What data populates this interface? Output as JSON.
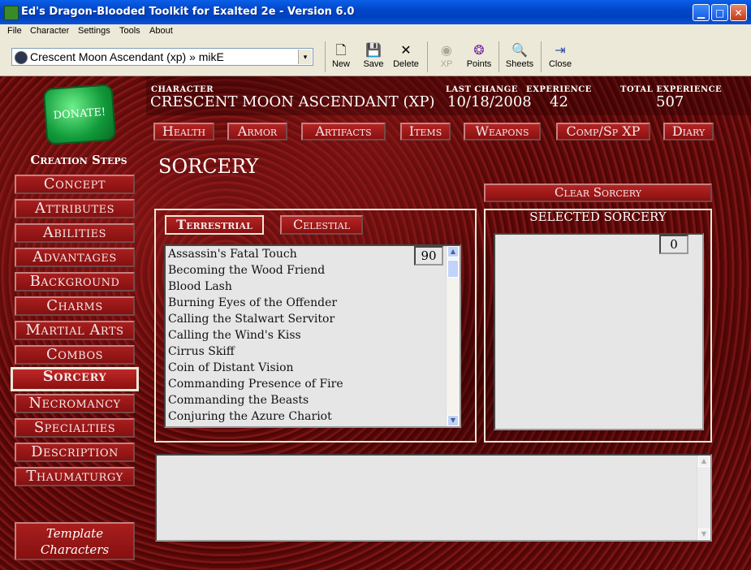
{
  "window": {
    "title": "Ed's Dragon-Blooded Toolkit for Exalted 2e - Version 6.0",
    "minimize": "▁",
    "maximize": "□",
    "close": "✕"
  },
  "menu": [
    "File",
    "Character",
    "Settings",
    "Tools",
    "About"
  ],
  "toolbar": {
    "character_select": "Crescent Moon Ascendant (xp) » mikE",
    "dropdown_glyph": "▾",
    "buttons": {
      "new": "New",
      "save": "Save",
      "delete": "Delete",
      "xp": "XP",
      "points": "Points",
      "sheets": "Sheets",
      "close": "Close"
    },
    "icons": {
      "new": "new-document-icon",
      "save": "floppy-disk-icon",
      "delete": "x-icon",
      "xp": "xp-icon",
      "points": "points-icon",
      "sheets": "sheets-icon",
      "close": "exit-door-icon"
    }
  },
  "header": {
    "character_label": "CHARACTER",
    "character_name": "CRESCENT MOON ASCENDANT (XP)",
    "last_change_label": "LAST CHANGE",
    "last_change": "10/18/2008",
    "experience_label": "EXPERIENCE",
    "experience": "42",
    "total_experience_label": "TOTAL EXPERIENCE",
    "total_experience": "507"
  },
  "top_tabs": [
    "Health",
    "Armor",
    "Artifacts",
    "Items",
    "Weapons",
    "Comp/Sp XP",
    "Diary"
  ],
  "donate": "DONATE!",
  "creation_steps": {
    "title": "Creation Steps",
    "items": [
      "Concept",
      "Attributes",
      "Abilities",
      "Advantages",
      "Background",
      "Charms",
      "Martial Arts",
      "Combos",
      "Sorcery",
      "Necromancy",
      "Specialties",
      "Description",
      "Thaumaturgy"
    ],
    "active": "Sorcery"
  },
  "template_button": "Template Characters",
  "sorcery": {
    "title": "SORCERY",
    "clear_button": "Clear Sorcery",
    "tab_terrestrial": "Terrestrial",
    "tab_celestial": "Celestial",
    "available_count": "90",
    "spells": [
      "Assassin's Fatal Touch",
      "Becoming the Wood Friend",
      "Blood Lash",
      "Burning Eyes of the Offender",
      "Calling the Stalwart Servitor",
      "Calling the Wind's Kiss",
      "Cirrus Skiff",
      "Coin of Distant Vision",
      "Commanding Presence of Fire",
      "Commanding the Beasts",
      "Conjuring the Azure Chariot"
    ],
    "selected_title": "SELECTED SORCERY",
    "selected_count": "0"
  },
  "accent_colors": {
    "background_red": "#6b0f0f",
    "button_red": "#a81e1e",
    "panel_gray": "#e6e6e6"
  }
}
